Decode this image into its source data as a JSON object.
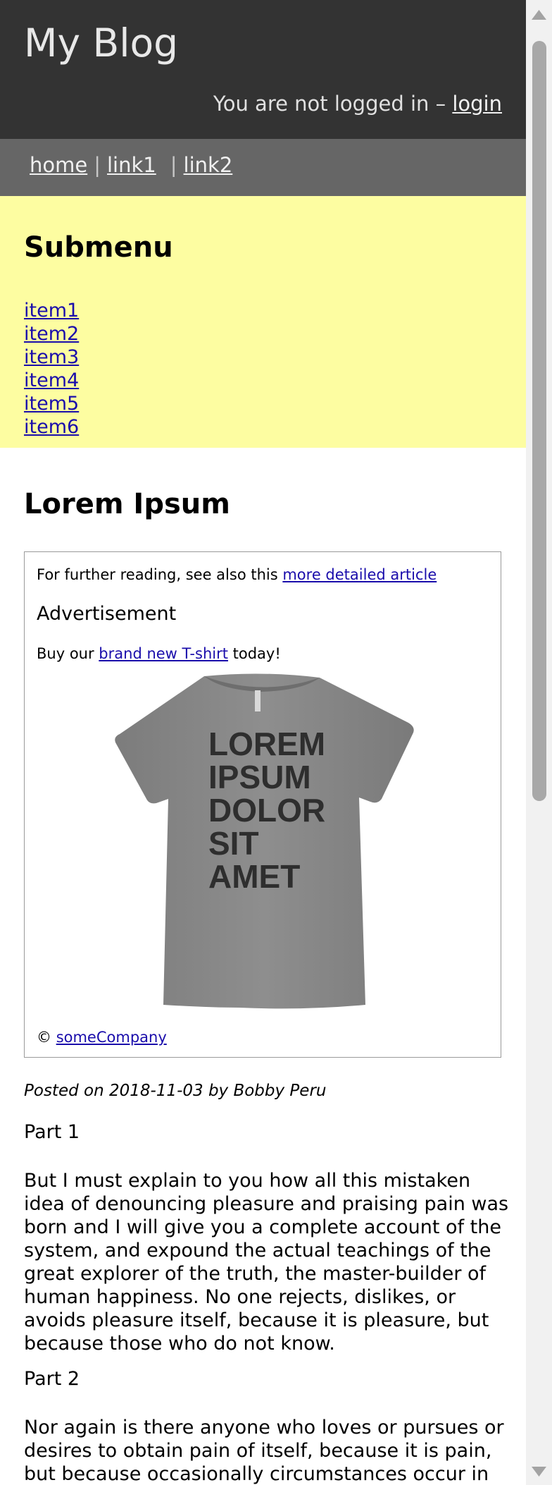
{
  "header": {
    "title": "My Blog",
    "login_prefix": "You are not logged in – ",
    "login_link": "login"
  },
  "nav": {
    "items": [
      "home",
      "link1",
      "link2"
    ],
    "separator": "|"
  },
  "submenu": {
    "title": "Submenu",
    "items": [
      "item1",
      "item2",
      "item3",
      "item4",
      "item5",
      "item6"
    ]
  },
  "article": {
    "title": "Lorem Ipsum",
    "aside": {
      "further_prefix": "For further reading, see also this ",
      "further_link": "more detailed article",
      "ad_heading": "Advertisement",
      "ad_prefix": "Buy our ",
      "ad_link": "brand new T-shirt",
      "ad_suffix": " today!",
      "tshirt_text": [
        "LOREM",
        "IPSUM",
        "DOLOR",
        "SIT",
        "AMET"
      ],
      "credit_symbol": "©",
      "credit_link": "someCompany"
    },
    "byline": "Posted on 2018-11-03 by Bobby Peru",
    "parts": [
      {
        "title": "Part 1",
        "text": "But I must explain to you how all this mistaken idea of denouncing pleasure and praising pain was born and I will give you a complete account of the system, and expound the actual teachings of the great explorer of the truth, the master-builder of human happiness. No one rejects, dislikes, or avoids pleasure itself, because it is pleasure, but because those who do not know."
      },
      {
        "title": "Part 2",
        "text": "Nor again is there anyone who loves or pursues or desires to obtain pain of itself, because it is pain, but because occasionally circumstances occur in"
      }
    ]
  },
  "colors": {
    "header_bg": "#333333",
    "nav_bg": "#666666",
    "submenu_bg": "#fdfda1",
    "link": "#1a0dab",
    "tshirt": "#8a8a8a",
    "tshirt_text": "#2e2e2e"
  },
  "icons": {
    "scroll_up": "triangle-up-icon",
    "scroll_down": "triangle-down-icon"
  }
}
